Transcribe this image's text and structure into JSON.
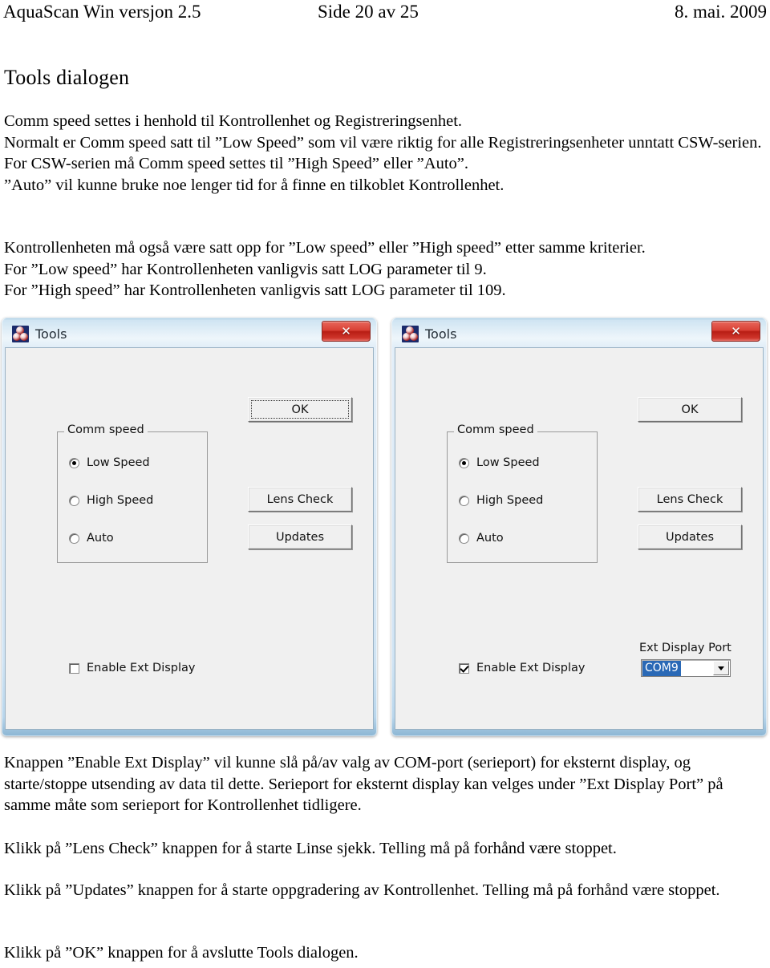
{
  "header": {
    "left": "AquaScan Win versjon 2.5",
    "middle": "Side 20 av 25",
    "right": "8. mai. 2009"
  },
  "section_title": "Tools dialogen",
  "body": {
    "block_a": [
      "Comm speed settes i henhold til Kontrollenhet og Registreringsenhet.",
      "Normalt er Comm speed satt til ”Low Speed” som vil være riktig for alle Registreringsenheter unntatt CSW-serien.",
      "For CSW-serien må Comm speed settes til ”High Speed” eller ”Auto”.",
      "”Auto” vil kunne bruke noe lenger tid for å finne en tilkoblet Kontrollenhet."
    ],
    "block_b": [
      "Kontrollenheten må også være satt opp for ”Low speed” eller ”High speed” etter samme kriterier.",
      "For ”Low speed” har Kontrollenheten vanligvis satt LOG parameter til 9.",
      "For ”High speed” har Kontrollenheten vanligvis satt LOG parameter til 109."
    ],
    "block_c": "Knappen ”Enable Ext Display” vil kunne slå på/av valg av COM-port (serieport) for eksternt display, og starte/stoppe utsending av data til dette. Serieport for eksternt display kan velges under ”Ext Display Port” på samme måte som serieport for Kontrollenhet tidligere.",
    "block_d": "Klikk på ”Lens Check” knappen for å starte Linse sjekk. Telling må på forhånd være stoppet.",
    "block_e": "Klikk på ”Updates” knappen for å starte oppgradering av Kontrollenhet. Telling må på forhånd være stoppet.",
    "block_f": "Klikk på ”OK” knappen for å avslutte Tools dialogen."
  },
  "dialog_left": {
    "title": "Tools",
    "close_label": "✕",
    "groupbox_label": "Comm speed",
    "radios": [
      {
        "label": "Low Speed",
        "selected": true
      },
      {
        "label": "High Speed",
        "selected": false
      },
      {
        "label": "Auto",
        "selected": false
      }
    ],
    "buttons": {
      "ok": "OK",
      "lens_check": "Lens Check",
      "updates": "Updates"
    },
    "ok_focused": true,
    "checkbox": {
      "label": "Enable Ext Display",
      "checked": false
    },
    "ext_display_port": {
      "visible": false,
      "caption": "Ext Display Port",
      "value": ""
    }
  },
  "dialog_right": {
    "title": "Tools",
    "close_label": "✕",
    "groupbox_label": "Comm speed",
    "radios": [
      {
        "label": "Low Speed",
        "selected": true
      },
      {
        "label": "High Speed",
        "selected": false
      },
      {
        "label": "Auto",
        "selected": false
      }
    ],
    "buttons": {
      "ok": "OK",
      "lens_check": "Lens Check",
      "updates": "Updates"
    },
    "ok_focused": false,
    "checkbox": {
      "label": "Enable Ext Display",
      "checked": true
    },
    "ext_display_port": {
      "visible": true,
      "caption": "Ext Display Port",
      "value": "COM9"
    }
  },
  "colors": {
    "close_button": "#d94034",
    "combo_selection": "#2a69b6",
    "dialog_face": "#f0f0f0",
    "title_bar": "#dceaf6"
  }
}
